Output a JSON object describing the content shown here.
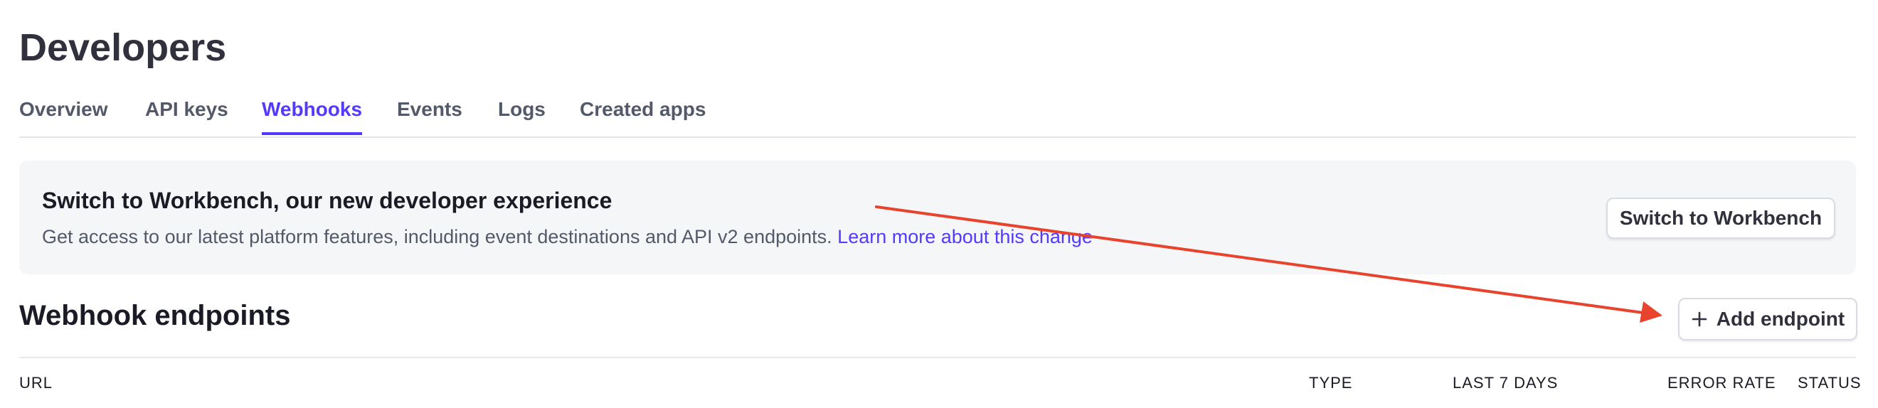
{
  "header": {
    "title": "Developers"
  },
  "tabs": [
    {
      "label": "Overview",
      "active": false
    },
    {
      "label": "API keys",
      "active": false
    },
    {
      "label": "Webhooks",
      "active": true
    },
    {
      "label": "Events",
      "active": false
    },
    {
      "label": "Logs",
      "active": false
    },
    {
      "label": "Created apps",
      "active": false
    }
  ],
  "banner": {
    "title": "Switch to Workbench, our new developer experience",
    "description": "Get access to our latest platform features, including event destinations and API v2 endpoints.",
    "link_label": "Learn more about this change",
    "button_label": "Switch to Workbench"
  },
  "section": {
    "title": "Webhook endpoints",
    "add_button_label": "Add endpoint",
    "add_button_icon": "plus-icon"
  },
  "table": {
    "columns": [
      "URL",
      "TYPE",
      "LAST 7 DAYS",
      "ERROR RATE",
      "STATUS"
    ]
  },
  "colors": {
    "accent": "#533afd",
    "annotation": "#e8432d",
    "banner_bg": "#f5f6f8"
  }
}
